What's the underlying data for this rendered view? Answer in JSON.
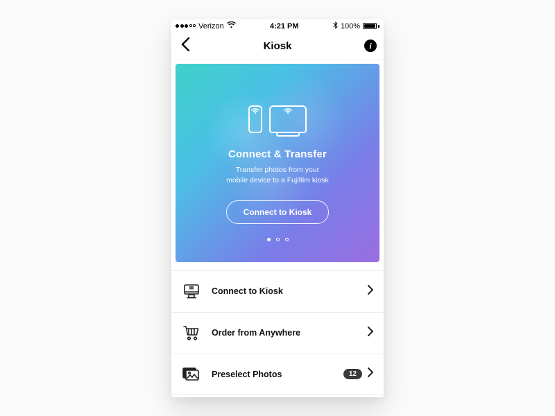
{
  "status": {
    "carrier": "Verizon",
    "time": "4:21 PM",
    "battery_pct": "100%"
  },
  "nav": {
    "title": "Kiosk"
  },
  "hero": {
    "title": "Connect & Transfer",
    "sub_line1": "Transfer photos from your",
    "sub_line2": "mobile device to a Fujifilm kiosk",
    "cta": "Connect to Kiosk",
    "page_count": 3,
    "active_page": 0
  },
  "list": [
    {
      "label": "Connect to Kiosk",
      "icon": "kiosk-monitor-icon",
      "badge": null
    },
    {
      "label": "Order from Anywhere",
      "icon": "cart-icon",
      "badge": null
    },
    {
      "label": "Preselect Photos",
      "icon": "photos-stack-icon",
      "badge": "12"
    }
  ]
}
